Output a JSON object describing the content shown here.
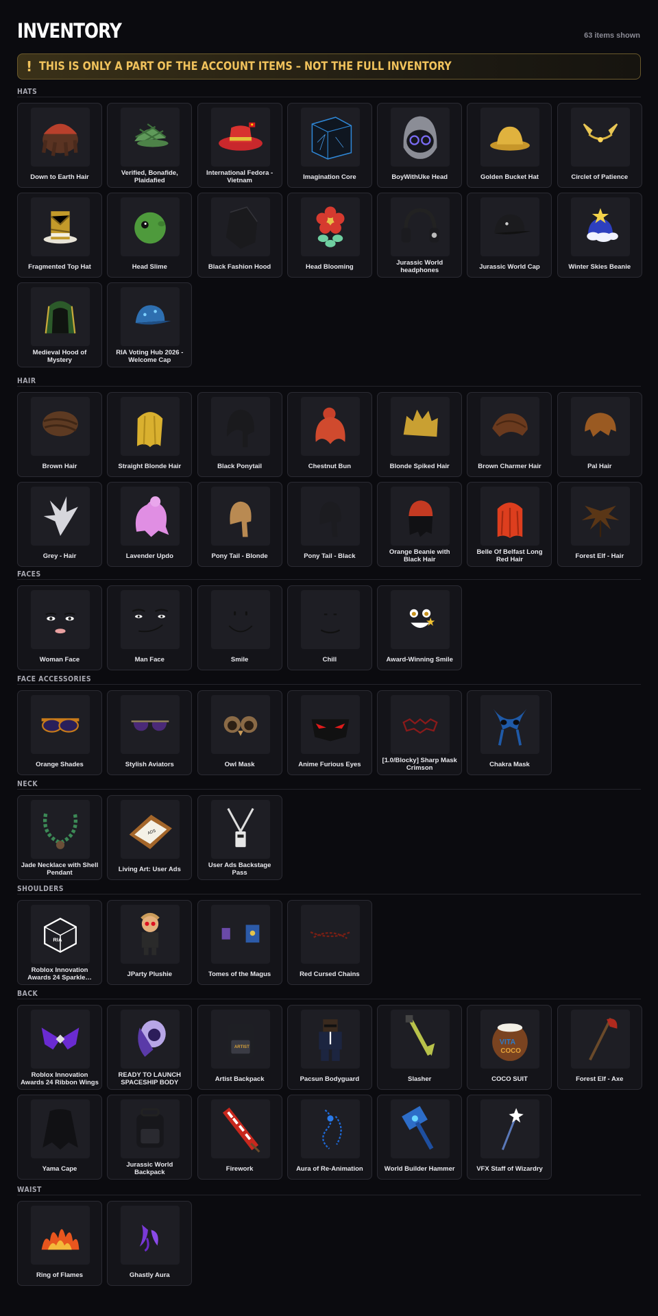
{
  "page": {
    "title": "INVENTORY",
    "count": "63 items shown",
    "warning_icon": "!",
    "warning": "THIS IS ONLY A PART OF THE ACCOUNT ITEMS – NOT THE FULL INVENTORY"
  },
  "sections": [
    {
      "label": "HATS",
      "items": [
        {
          "name": "Down to Earth Hair",
          "icon": "hair-beanie"
        },
        {
          "name": "Verified, Bonafide, Plaidafied",
          "icon": "plaid-cap"
        },
        {
          "name": "International Fedora - Vietnam",
          "icon": "fedora-red"
        },
        {
          "name": "Imagination Core",
          "icon": "cube"
        },
        {
          "name": "BoyWithUke Head",
          "icon": "hood-head"
        },
        {
          "name": "Golden Bucket Hat",
          "icon": "bucket-hat"
        },
        {
          "name": "Circlet of Patience",
          "icon": "circlet"
        },
        {
          "name": "Fragmented Top Hat",
          "icon": "top-hat"
        },
        {
          "name": "Head Slime",
          "icon": "slime"
        },
        {
          "name": "Black Fashion Hood",
          "icon": "black-hood"
        },
        {
          "name": "Head Blooming",
          "icon": "flower"
        },
        {
          "name": "Jurassic World headphones",
          "icon": "headphones"
        },
        {
          "name": "Jurassic World Cap",
          "icon": "black-cap"
        },
        {
          "name": "Winter Skies Beanie",
          "icon": "cloud-beanie"
        },
        {
          "name": "Medieval Hood of Mystery",
          "icon": "green-hood"
        },
        {
          "name": "RIA Voting Hub 2026 - Welcome Cap",
          "icon": "blue-cap"
        }
      ]
    },
    {
      "label": "HAIR",
      "items": [
        {
          "name": "Brown Hair",
          "icon": "hair-brown"
        },
        {
          "name": "Straight Blonde Hair",
          "icon": "hair-long-blonde"
        },
        {
          "name": "Black Ponytail",
          "icon": "hair-black"
        },
        {
          "name": "Chestnut Bun",
          "icon": "hair-red"
        },
        {
          "name": "Blonde Spiked Hair",
          "icon": "hair-spiked"
        },
        {
          "name": "Brown Charmer Hair",
          "icon": "hair-brown2"
        },
        {
          "name": "Pal Hair",
          "icon": "hair-pal"
        },
        {
          "name": "Grey - Hair",
          "icon": "hair-grey"
        },
        {
          "name": "Lavender Updo",
          "icon": "hair-lavender"
        },
        {
          "name": "Pony Tail - Blonde",
          "icon": "hair-pony-blonde"
        },
        {
          "name": "Pony Tail - Black",
          "icon": "hair-pony-black"
        },
        {
          "name": "Orange Beanie with Black Hair",
          "icon": "hair-orange-beanie"
        },
        {
          "name": "Belle Of Belfast Long Red Hair",
          "icon": "hair-long-red"
        },
        {
          "name": "Forest Elf - Hair",
          "icon": "hair-elf"
        }
      ]
    },
    {
      "label": "FACES",
      "items": [
        {
          "name": "Woman Face",
          "icon": "face-woman"
        },
        {
          "name": "Man Face",
          "icon": "face-man"
        },
        {
          "name": "Smile",
          "icon": "face-smile"
        },
        {
          "name": "Chill",
          "icon": "face-chill"
        },
        {
          "name": "Award-Winning Smile",
          "icon": "face-award"
        }
      ]
    },
    {
      "label": "FACE ACCESSORIES",
      "items": [
        {
          "name": "Orange Shades",
          "icon": "shades-orange"
        },
        {
          "name": "Stylish Aviators",
          "icon": "aviators"
        },
        {
          "name": "Owl Mask",
          "icon": "owl-mask"
        },
        {
          "name": "Anime Furious Eyes",
          "icon": "furious-eyes"
        },
        {
          "name": "[1.0/Blocky] Sharp Mask Crimson",
          "icon": "crimson-mask"
        },
        {
          "name": "Chakra Mask",
          "icon": "chakra-mask"
        }
      ]
    },
    {
      "label": "NECK",
      "items": [
        {
          "name": "Jade Necklace with Shell Pendant",
          "icon": "necklace"
        },
        {
          "name": "Living Art: User Ads",
          "icon": "art-frame"
        },
        {
          "name": "User Ads Backstage Pass",
          "icon": "lanyard"
        }
      ]
    },
    {
      "label": "SHOULDERS",
      "items": [
        {
          "name": "Roblox Innovation Awards 24 Sparkle…",
          "icon": "sparkle-cube"
        },
        {
          "name": "JParty Plushie",
          "icon": "plushie"
        },
        {
          "name": "Tomes of the Magus",
          "icon": "tomes"
        },
        {
          "name": "Red Cursed Chains",
          "icon": "chains"
        }
      ]
    },
    {
      "label": "BACK",
      "items": [
        {
          "name": "Roblox Innovation Awards 24 Ribbon Wings",
          "icon": "ribbon-wings"
        },
        {
          "name": "READY TO LAUNCH SPACESHIP BODY",
          "icon": "spaceship"
        },
        {
          "name": "Artist Backpack",
          "icon": "backpack-artist"
        },
        {
          "name": "Pacsun Bodyguard",
          "icon": "bodyguard"
        },
        {
          "name": "Slasher",
          "icon": "slasher"
        },
        {
          "name": "COCO SUIT",
          "icon": "coconut"
        },
        {
          "name": "Forest Elf - Axe",
          "icon": "axe"
        },
        {
          "name": "Yama Cape",
          "icon": "cape"
        },
        {
          "name": "Jurassic World Backpack",
          "icon": "backpack-black"
        },
        {
          "name": "Firework",
          "icon": "firework"
        },
        {
          "name": "Aura of Re-Animation",
          "icon": "aura-blue"
        },
        {
          "name": "World Builder Hammer",
          "icon": "hammer"
        },
        {
          "name": "VFX Staff of Wizardry",
          "icon": "staff"
        }
      ]
    },
    {
      "label": "WAIST",
      "items": [
        {
          "name": "Ring of Flames",
          "icon": "flames"
        },
        {
          "name": "Ghastly Aura",
          "icon": "ghastly"
        }
      ]
    }
  ]
}
